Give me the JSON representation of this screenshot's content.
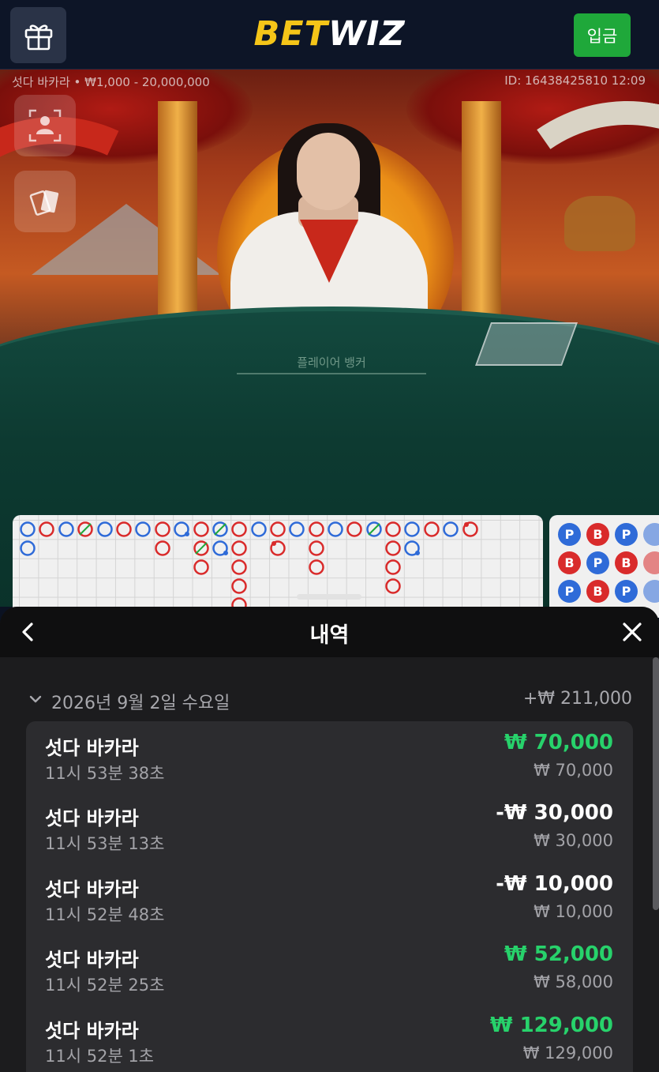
{
  "header": {
    "logo_part1": "BET",
    "logo_part2": "WIZ",
    "deposit_label": "입금",
    "gift_icon": "gift-icon"
  },
  "video": {
    "table_info": "섯다 바카라 • ₩1,000 - 20,000,000",
    "round_id": "ID: 16438425810 12:09",
    "table_label": "플레이어  뱅커"
  },
  "roadmap": {
    "colors": {
      "player": "#2f6bd8",
      "banker": "#d92b2b"
    },
    "bead_labels": {
      "player": "P",
      "banker": "B"
    }
  },
  "history": {
    "title": "내역",
    "day": {
      "date": "2026년 9월 2일 수요일",
      "total": "+₩ 211,000"
    },
    "entries": [
      {
        "game": "섯다 바카라",
        "time": "11시 53분 38초",
        "result": "₩ 70,000",
        "stake": "₩ 70,000",
        "outcome": "win"
      },
      {
        "game": "섯다 바카라",
        "time": "11시 53분 13초",
        "result": "-₩ 30,000",
        "stake": "₩ 30,000",
        "outcome": "loss"
      },
      {
        "game": "섯다 바카라",
        "time": "11시 52분 48초",
        "result": "-₩ 10,000",
        "stake": "₩ 10,000",
        "outcome": "loss"
      },
      {
        "game": "섯다 바카라",
        "time": "11시 52분 25초",
        "result": "₩ 52,000",
        "stake": "₩ 58,000",
        "outcome": "win"
      },
      {
        "game": "섯다 바카라",
        "time": "11시 52분 1초",
        "result": "₩ 129,000",
        "stake": "₩ 129,000",
        "outcome": "win"
      }
    ],
    "accent_win": "#27d26b"
  }
}
